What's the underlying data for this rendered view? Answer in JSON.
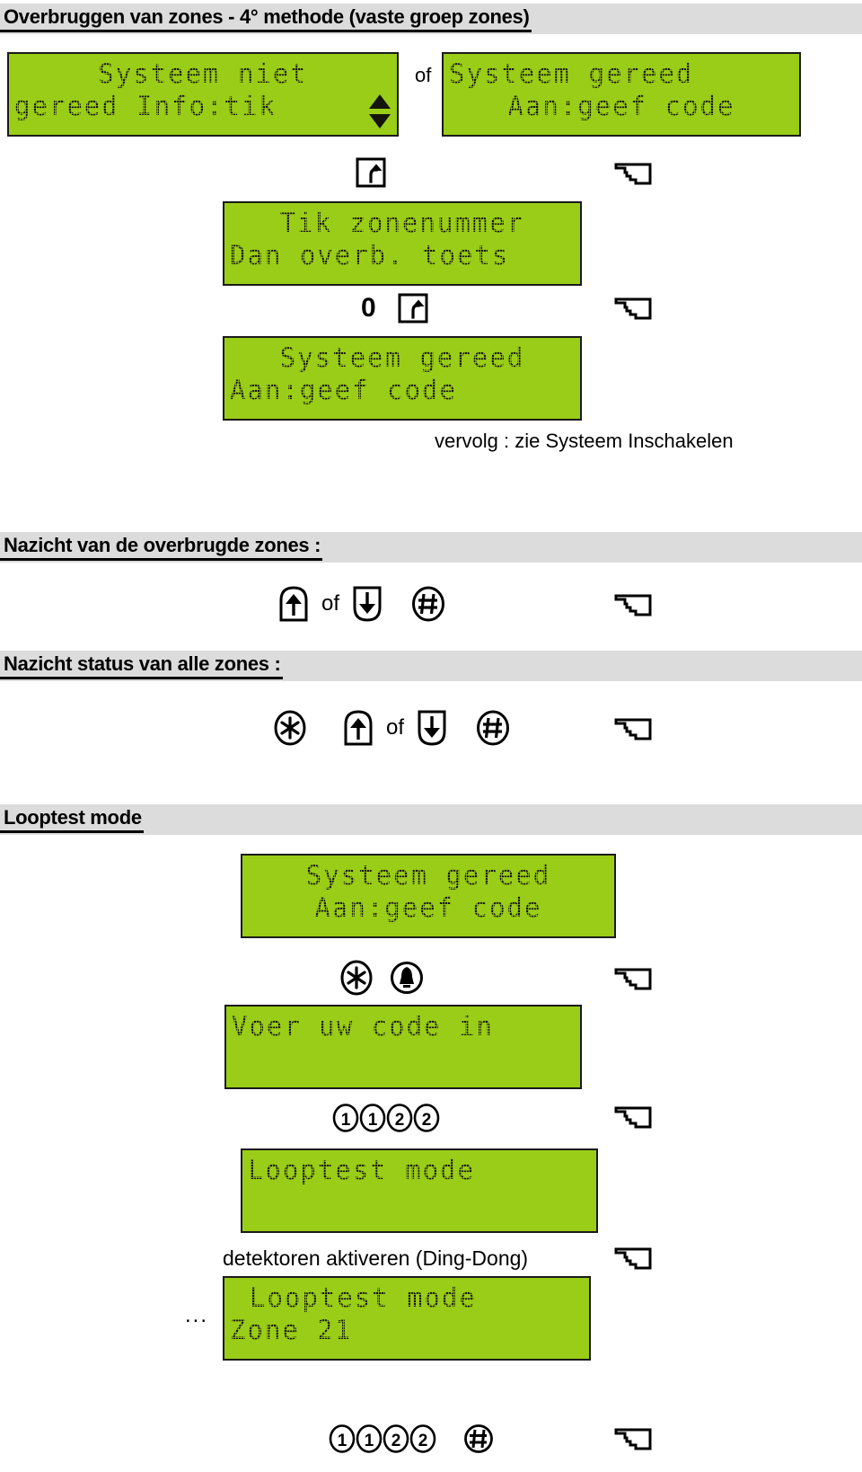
{
  "page": {
    "colors": {
      "lcd_background": "#9acd17",
      "lcd_text": "#15150d",
      "section_bar": "#dcdcdc",
      "page_background": "#ffffff",
      "ink": "#000000"
    }
  },
  "sections": [
    {
      "id": "bypass",
      "title": "Overbruggen van zones - 4° methode (vaste groep zones)"
    },
    {
      "id": "review-bypassed",
      "title": "Nazicht van de overbrugde zones :"
    },
    {
      "id": "review-all",
      "title": "Nazicht status van alle zones :"
    },
    {
      "id": "walktest",
      "title": "Looptest mode"
    }
  ],
  "displays": {
    "system_not_ready": {
      "line1": "Systeem niet",
      "line2": "gereed Info:tik",
      "scroll_indicator": "up-down-triangles"
    },
    "system_ready_1": {
      "line1": "Systeem gereed",
      "line2": "Aan:geef code"
    },
    "enter_zone": {
      "line1": "Tik zonenummer",
      "line2": "Dan overb. toets"
    },
    "system_ready_2": {
      "line1": "Systeem gereed",
      "line2": "Aan:geef code"
    },
    "system_ready_3": {
      "line1": "Systeem gereed",
      "line2": "Aan:geef code"
    },
    "enter_code": {
      "line1": "Voer uw code in",
      "line2": ""
    },
    "walktest_mode": {
      "line1": "Looptest mode",
      "line2": ""
    },
    "walktest_zone": {
      "line1": "Looptest mode",
      "line2": "Zone 21"
    }
  },
  "labels": {
    "of": "of",
    "continuation": "vervolg : zie Systeem Inschakelen",
    "activate_detectors": "detektoren aktiveren  (Ding-Dong)",
    "ellipsis": "..."
  },
  "keys": {
    "bypass": {
      "name": "bypass-key",
      "glyph": "boxed-curved-up-arrow"
    },
    "zero": {
      "name": "zero-key",
      "label": "0"
    },
    "up": {
      "name": "up-arrow-key",
      "glyph": "shield-up-arrow"
    },
    "down": {
      "name": "down-arrow-key",
      "glyph": "shield-down-arrow"
    },
    "hash": {
      "name": "hash-key",
      "glyph": "circled-hash"
    },
    "star": {
      "name": "star-key",
      "glyph": "oval-asterisk"
    },
    "bell": {
      "name": "bell-key",
      "glyph": "circled-bell"
    },
    "one": {
      "name": "one-key",
      "label": "1"
    },
    "two": {
      "name": "two-key",
      "label": "2"
    },
    "hand": {
      "name": "pointing-hand-icon",
      "glyph": "pointing-hand"
    }
  },
  "code_sequences": {
    "user_code": [
      "1",
      "1",
      "2",
      "2"
    ],
    "user_code_with_hash": [
      "1",
      "1",
      "2",
      "2",
      "#"
    ]
  }
}
